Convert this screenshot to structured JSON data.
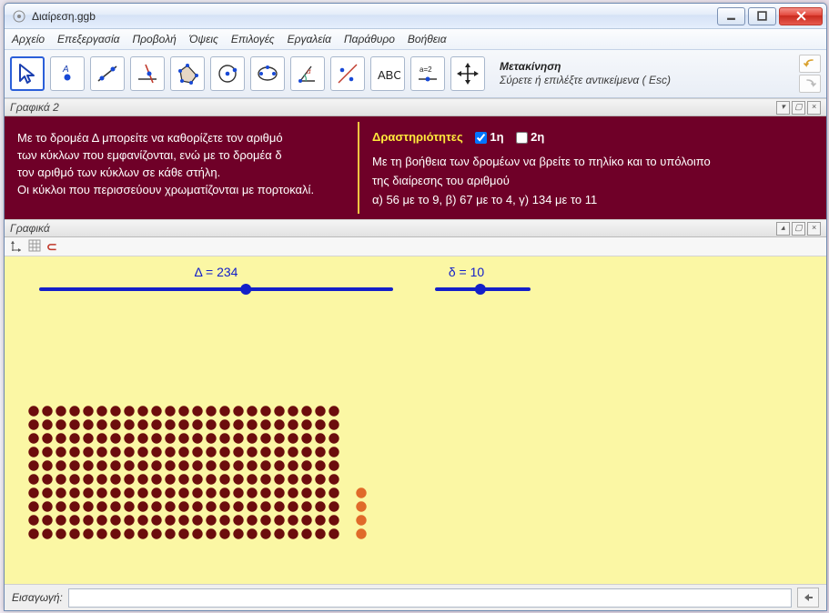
{
  "window": {
    "title": "Διαίρεση.ggb"
  },
  "menu": {
    "file": "Αρχείο",
    "edit": "Επεξεργασία",
    "view": "Προβολή",
    "pers": "Όψεις",
    "options": "Επιλογές",
    "tools": "Εργαλεία",
    "window": "Παράθυρο",
    "help": "Βοήθεια"
  },
  "toolbar": {
    "hint_title": "Μετακίνηση",
    "hint_desc": "Σύρετε ή επιλέξτε αντικείμενα ( Esc)"
  },
  "panels": {
    "graphics2": "Γραφικά 2",
    "graphics": "Γραφικά"
  },
  "gr2": {
    "left_line1": "Με το δρομέα Δ μπορείτε να καθορίζετε τον αριθμό",
    "left_line2": "των κύκλων που εμφανίζονται, ενώ με το δρομέα δ",
    "left_line3": "τον αριθμό των κύκλων σε κάθε στήλη.",
    "left_line4": "Οι κύκλοι που περισσεύουν χρωματίζονται με πορτοκαλί.",
    "act_head": "Δραστηριότητες",
    "cb1_label": "1η",
    "cb2_label": "2η",
    "r1": "Με τη βοήθεια των δρομέων να βρείτε το πηλίκο και το υπόλοιπο",
    "r2": "της διαίρεσης του αριθμού",
    "r3": "α) 56 με το 9,  β)  67 με το 4, γ) 134 με το 11"
  },
  "sliders": {
    "D": {
      "label": "Δ = 234",
      "value": 234,
      "min": 0,
      "max": 400
    },
    "d": {
      "label": "δ = 10",
      "value": 10,
      "min": 1,
      "max": 20
    }
  },
  "grid": {
    "total": 234,
    "cols": 23,
    "full_rows": 10,
    "remainder": 4,
    "dot_color": "#6c0d0d",
    "remainder_color": "#e06a2a"
  },
  "inputbar": {
    "label": "Εισαγωγή:",
    "value": ""
  },
  "checkboxes": {
    "cb1": true,
    "cb2": false
  },
  "colors": {
    "accent": "#2b5fd9",
    "panel": "#6f0028",
    "canvas": "#fbf7a4"
  }
}
